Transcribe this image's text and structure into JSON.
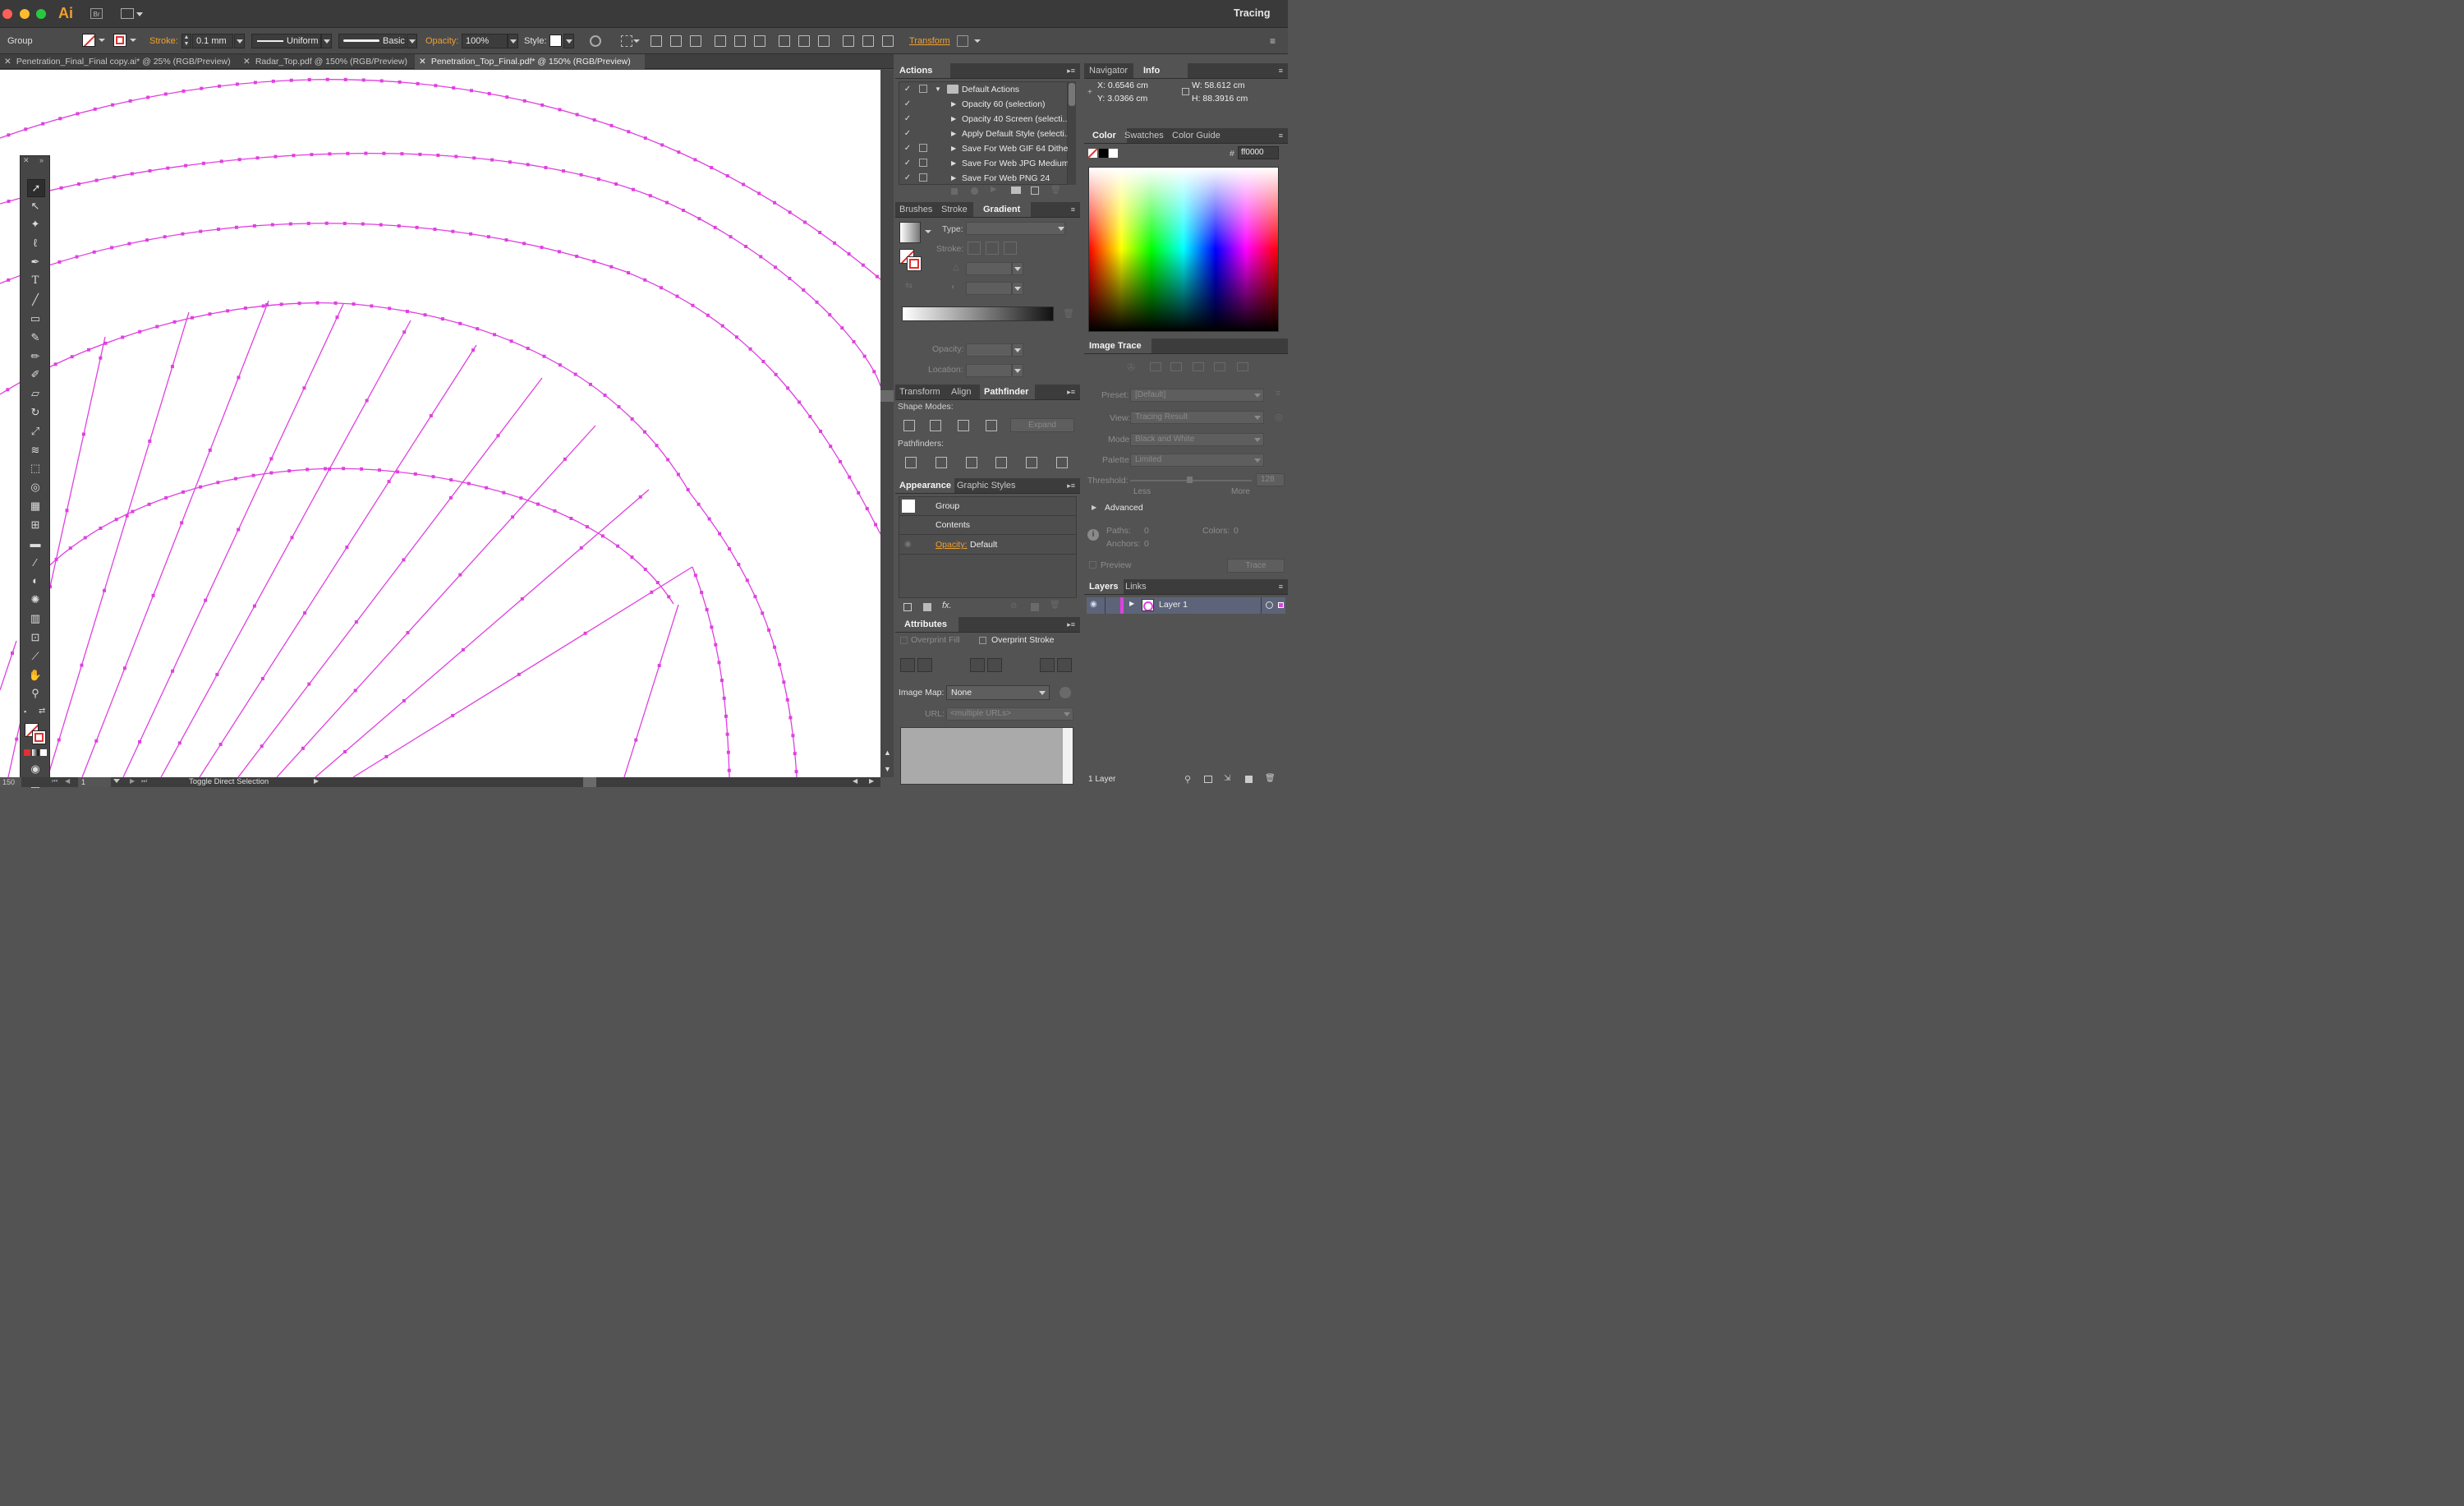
{
  "app": {
    "logo": "Ai",
    "bridge_badge": "Br",
    "workspace": "Tracing"
  },
  "control": {
    "selection_label": "Group",
    "stroke_label": "Stroke:",
    "stroke_value": "0.1 mm",
    "profile_label": "Uniform",
    "brush_label": "Basic",
    "opacity_label": "Opacity:",
    "opacity_value": "100%",
    "style_label": "Style:",
    "transform_label": "Transform"
  },
  "doc_tabs": [
    {
      "title": "Penetration_Final_Final copy.ai* @ 25% (RGB/Preview)",
      "active": false
    },
    {
      "title": "Radar_Top.pdf @ 150% (RGB/Preview)",
      "active": false
    },
    {
      "title": "Penetration_Top_Final.pdf* @ 150% (RGB/Preview)",
      "active": true
    }
  ],
  "status": {
    "zoom": "150",
    "page": "1",
    "tool_hint": "Toggle Direct Selection"
  },
  "actions": {
    "tab": "Actions",
    "set_name": "Default Actions",
    "items": [
      "Opacity 60 (selection)",
      "Opacity 40 Screen (selecti...",
      "Apply Default Style (selecti...",
      "Save For Web GIF 64 Dithe...",
      "Save For Web JPG Medium",
      "Save For Web PNG 24"
    ]
  },
  "gradient_panel": {
    "tabs": [
      "Brushes",
      "Stroke",
      "Gradient"
    ],
    "type_label": "Type:",
    "stroke_label": "Stroke:",
    "opacity_label": "Opacity:",
    "location_label": "Location:"
  },
  "pathfinder_panel": {
    "tabs": [
      "Transform",
      "Align",
      "Pathfinder"
    ],
    "shape_modes_label": "Shape Modes:",
    "expand_label": "Expand",
    "pathfinders_label": "Pathfinders:"
  },
  "appearance_panel": {
    "tabs": [
      "Appearance",
      "Graphic Styles"
    ],
    "object_label": "Group",
    "contents_label": "Contents",
    "opacity_label": "Opacity:",
    "opacity_value": "Default"
  },
  "attributes_panel": {
    "tab": "Attributes",
    "overprint_fill": "Overprint Fill",
    "overprint_stroke": "Overprint Stroke",
    "image_map_label": "Image Map:",
    "image_map_value": "None",
    "url_label": "URL:",
    "url_value": "<multiple URLs>"
  },
  "navigator_panel": {
    "tabs": [
      "Navigator",
      "Info"
    ],
    "x": "X:  0.6546 cm",
    "y": "Y:  3.0366 cm",
    "w": "W:  58.612 cm",
    "h": "H:  88.3916 cm"
  },
  "color_panel": {
    "tabs": [
      "Color",
      "Swatches",
      "Color Guide"
    ],
    "hash": "#",
    "hex_value": "ff0000"
  },
  "image_trace": {
    "title": "Image Trace",
    "preset_label": "Preset:",
    "preset_value": "[Default]",
    "view_label": "View:",
    "view_value": "Tracing Result",
    "mode_label": "Mode:",
    "mode_value": "Black and White",
    "palette_label": "Palette:",
    "palette_value": "Limited",
    "threshold_label": "Threshold:",
    "threshold_value": "128",
    "less_label": "Less",
    "more_label": "More",
    "advanced_label": "Advanced",
    "paths_label": "Paths:",
    "paths_value": "0",
    "colors_label": "Colors:",
    "colors_value": "0",
    "anchors_label": "Anchors:",
    "anchors_value": "0",
    "preview_label": "Preview",
    "trace_label": "Trace"
  },
  "layers_panel": {
    "tabs": [
      "Layers",
      "Links"
    ],
    "layer_name": "Layer 1",
    "count": "1 Layer"
  },
  "colors": {
    "path_magenta": "#e040e0",
    "accent_orange": "#f0a030",
    "panel_bg": "#535353",
    "canvas_bg": "#ffffff"
  }
}
